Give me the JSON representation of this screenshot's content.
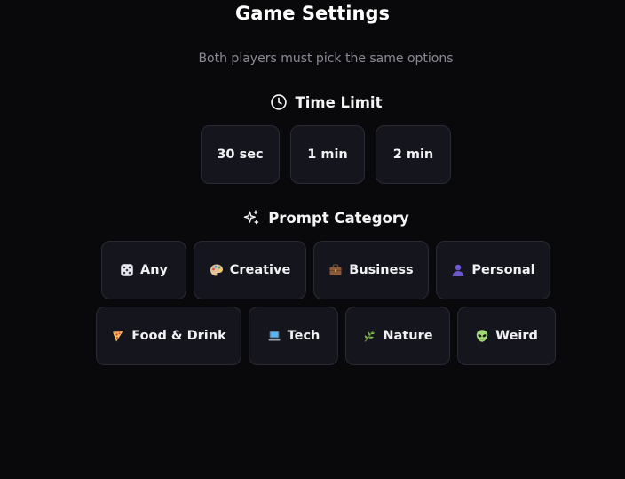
{
  "header": {
    "title": "Game Settings",
    "subtitle": "Both players must pick the same options"
  },
  "time_limit": {
    "heading": "Time Limit",
    "icon": "clock-icon",
    "options": [
      {
        "label": "30 sec"
      },
      {
        "label": "1 min"
      },
      {
        "label": "2 min"
      }
    ]
  },
  "prompt_category": {
    "heading": "Prompt Category",
    "icon": "sparkles-icon",
    "options": [
      {
        "label": "Any",
        "icon": "dice-icon"
      },
      {
        "label": "Creative",
        "icon": "palette-icon"
      },
      {
        "label": "Business",
        "icon": "briefcase-icon"
      },
      {
        "label": "Personal",
        "icon": "person-icon"
      },
      {
        "label": "Food & Drink",
        "icon": "pizza-icon"
      },
      {
        "label": "Tech",
        "icon": "laptop-icon"
      },
      {
        "label": "Nature",
        "icon": "herb-icon"
      },
      {
        "label": "Weird",
        "icon": "alien-icon"
      }
    ]
  },
  "colors": {
    "background": "#09090b",
    "button_background": "#15151d",
    "button_border": "#2a2a35",
    "subtitle": "#8b8b96"
  }
}
